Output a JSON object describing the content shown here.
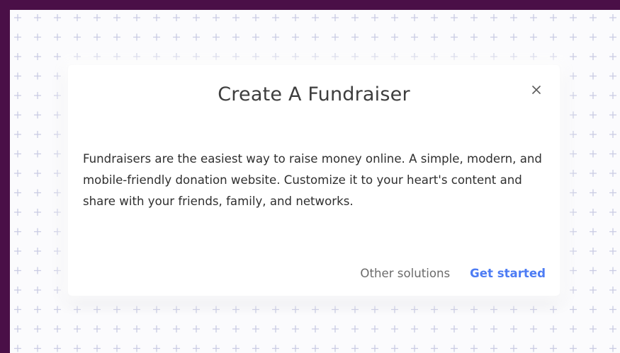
{
  "modal": {
    "title": "Create A Fundraiser",
    "close_icon": "close-icon",
    "body": "Fundraisers are the easiest way to raise money online. A simple, modern, and mobile-friendly donation website. Customize it to your heart's content and share with your friends, family, and networks.",
    "actions": {
      "secondary_label": "Other solutions",
      "primary_label": "Get started"
    }
  },
  "colors": {
    "frame": "#4a0f47",
    "pattern_plus": "#c9cbe3",
    "title_text": "#3d3d3d",
    "body_text": "#2f2f2f",
    "secondary_text": "#6b6b6b",
    "primary_accent": "#4d7cf4"
  }
}
